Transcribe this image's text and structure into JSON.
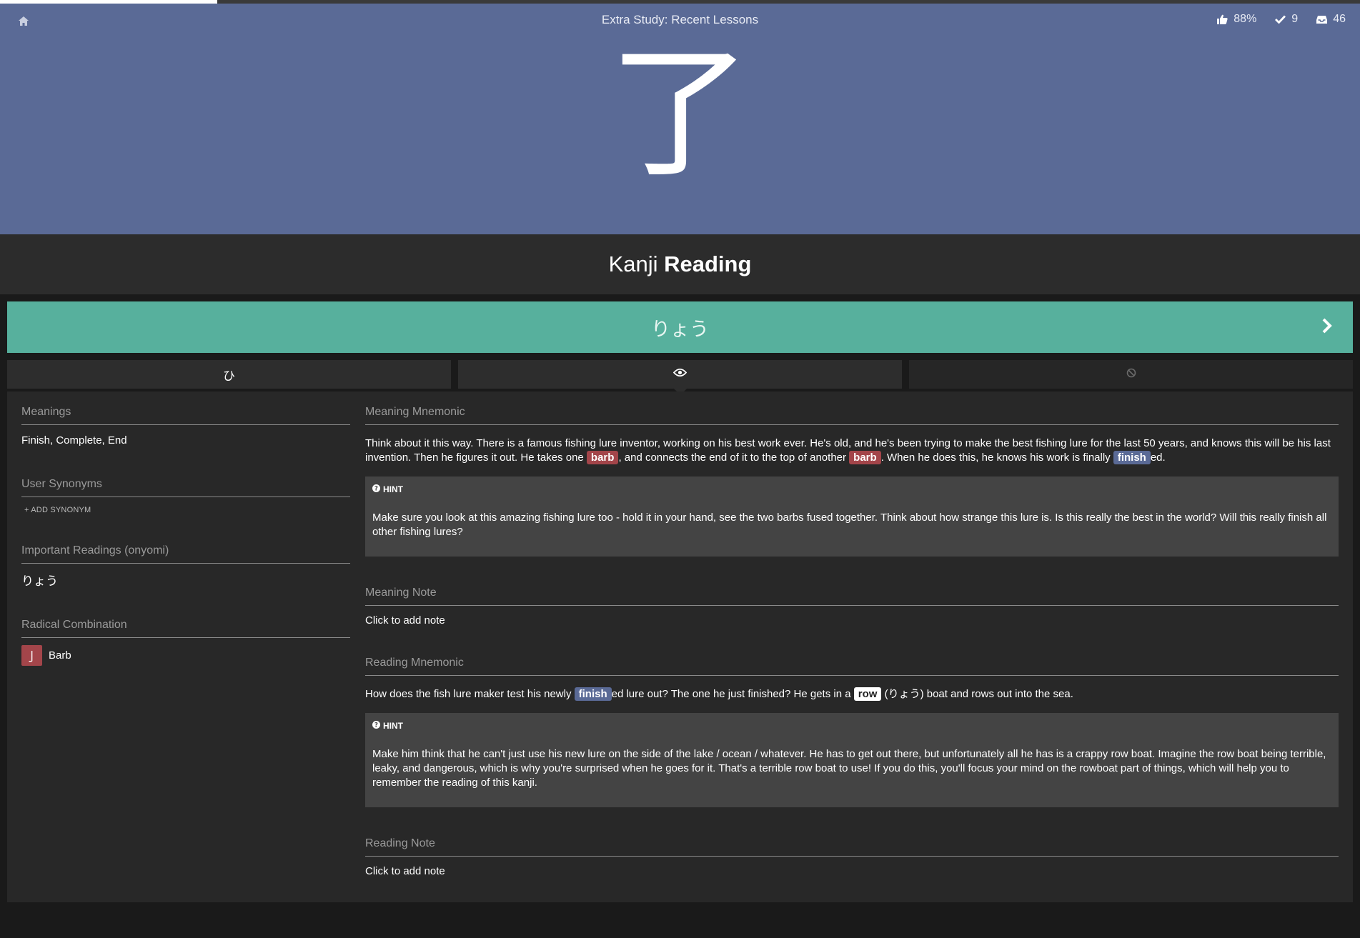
{
  "progress": {
    "fraction": 0.16
  },
  "header": {
    "title": "Extra Study: Recent Lessons",
    "home_icon": "home-icon",
    "stats": [
      {
        "icon": "thumbs-up-icon",
        "value": "88%"
      },
      {
        "icon": "checkmark-icon",
        "value": "9"
      },
      {
        "icon": "inbox-icon",
        "value": "46"
      }
    ],
    "character": "了",
    "bg_color": "#5a6a96"
  },
  "question": {
    "prefix": "Kanji",
    "type": "Reading"
  },
  "answer": {
    "value": "りょう",
    "bg_color": "#57b09d"
  },
  "tabs": [
    {
      "icon": "hiragana-toggle-icon",
      "glyph": "ひ"
    },
    {
      "icon": "eye-icon",
      "active": true
    },
    {
      "icon": "disabled-icon",
      "disabled": true
    }
  ],
  "left": {
    "meanings": {
      "heading": "Meanings",
      "value": "Finish, Complete, End"
    },
    "synonyms": {
      "heading": "User Synonyms",
      "add_label": "+ ADD SYNONYM"
    },
    "readings": {
      "heading": "Important Readings (onyomi)",
      "value": "りょう"
    },
    "radicals": {
      "heading": "Radical Combination",
      "items": [
        {
          "glyph": "亅",
          "name": "Barb"
        }
      ]
    }
  },
  "right": {
    "meaning_mnemonic": {
      "heading": "Meaning Mnemonic",
      "t1": "Think about it this way. There is a famous fishing lure inventor, working on his best work ever. He's old, and he's been trying to make the best fishing lure for the last 50 years, and knows this will be his last invention. Then he figures it out. He takes one ",
      "tag1": "barb",
      "t2": ", and connects the end of it to the top of another ",
      "tag2": "barb",
      "t3": ". When he does this, he knows his work is finally ",
      "tag3": "finish",
      "t4": "ed.",
      "hint_label": "HINT",
      "hint": "Make sure you look at this amazing fishing lure too - hold it in your hand, see the two barbs fused together. Think about how strange this lure is. Is this really the best in the world? Will this really finish all other fishing lures?"
    },
    "meaning_note": {
      "heading": "Meaning Note",
      "value": "Click to add note"
    },
    "reading_mnemonic": {
      "heading": "Reading Mnemonic",
      "t1": "How does the fish lure maker test his newly ",
      "tag1": "finish",
      "t2": "ed lure out? The one he just finished? He gets in a ",
      "tag2": "row",
      "t3": " (りょう) boat and rows out into the sea.",
      "hint_label": "HINT",
      "hint": "Make him think that he can't just use his new lure on the side of the lake / ocean / whatever. He has to get out there, but unfortunately all he has is a crappy row boat. Imagine the row boat being terrible, leaky, and dangerous, which is why you're surprised when he goes for it. That's a terrible row boat to use! If you do this, you'll focus your mind on the rowboat part of things, which will help you to remember the reading of this kanji."
    },
    "reading_note": {
      "heading": "Reading Note",
      "value": "Click to add note"
    }
  }
}
